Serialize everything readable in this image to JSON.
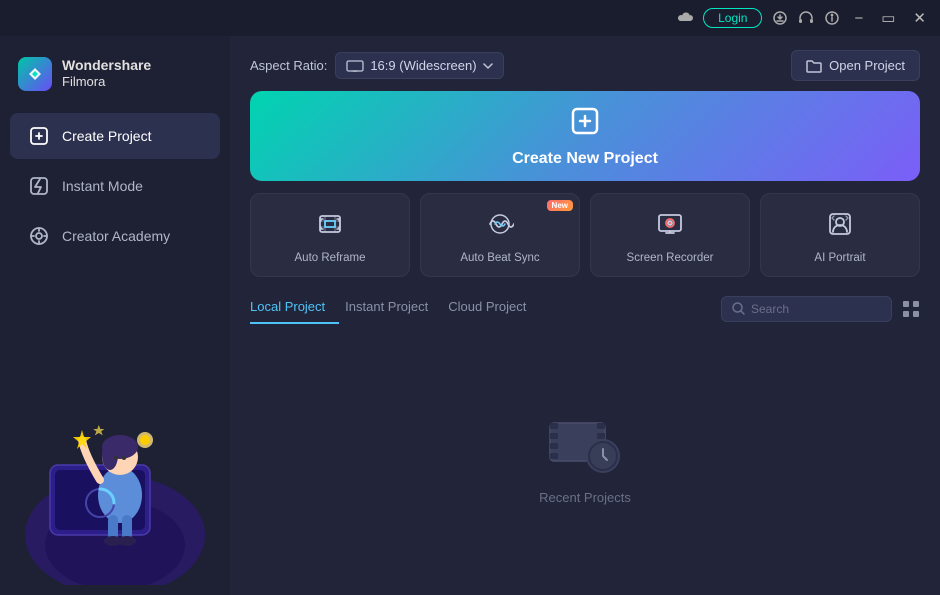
{
  "titlebar": {
    "login_label": "Login",
    "minimize_label": "−",
    "close_label": "✕"
  },
  "logo": {
    "brand_line1": "Wondershare",
    "brand_line2": "Filmora"
  },
  "nav": {
    "items": [
      {
        "id": "create-project",
        "label": "Create Project",
        "active": true
      },
      {
        "id": "instant-mode",
        "label": "Instant Mode",
        "active": false
      },
      {
        "id": "creator-academy",
        "label": "Creator Academy",
        "active": false
      }
    ]
  },
  "topbar": {
    "aspect_ratio_label": "Aspect Ratio:",
    "aspect_ratio_value": "16:9 (Widescreen)",
    "open_project_label": "Open Project"
  },
  "create_banner": {
    "label": "Create New Project"
  },
  "feature_cards": [
    {
      "id": "auto-reframe",
      "label": "Auto Reframe",
      "has_new": false
    },
    {
      "id": "auto-beat-sync",
      "label": "Auto Beat Sync",
      "has_new": true,
      "new_badge": "New"
    },
    {
      "id": "screen-recorder",
      "label": "Screen Recorder",
      "has_new": false
    },
    {
      "id": "ai-portrait",
      "label": "AI Portrait",
      "has_new": false
    }
  ],
  "project_tabs": [
    {
      "id": "local",
      "label": "Local Project",
      "active": true
    },
    {
      "id": "instant",
      "label": "Instant Project",
      "active": false
    },
    {
      "id": "cloud",
      "label": "Cloud Project",
      "active": false
    }
  ],
  "search": {
    "placeholder": "Search"
  },
  "empty_state": {
    "label": "Recent Projects"
  }
}
